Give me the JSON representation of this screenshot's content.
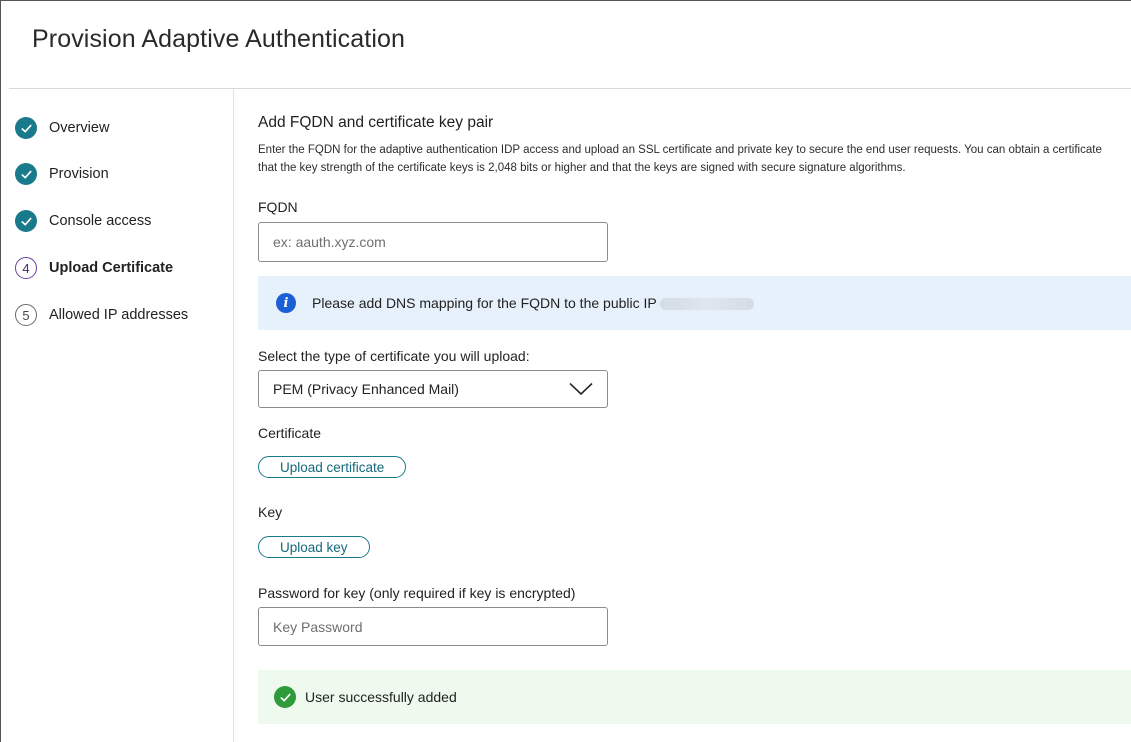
{
  "header": {
    "title": "Provision Adaptive Authentication"
  },
  "steps": [
    {
      "label": "Overview",
      "status": "done"
    },
    {
      "label": "Provision",
      "status": "done"
    },
    {
      "label": "Console access",
      "status": "done"
    },
    {
      "label": "Upload Certificate",
      "status": "current",
      "number": "4"
    },
    {
      "label": "Allowed IP addresses",
      "status": "pending",
      "number": "5"
    }
  ],
  "main": {
    "section_title": "Add FQDN and certificate key pair",
    "description_line1": "Enter the FQDN for the adaptive authentication IDP access and upload an SSL certificate and private key to secure the end user requests. You can obtain a certificate",
    "description_line2": "that the key strength of the certificate keys is 2,048 bits or higher and that the keys are signed with secure signature algorithms.",
    "fqdn": {
      "label": "FQDN",
      "placeholder": "ex: aauth.xyz.com",
      "value": ""
    },
    "info_banner": {
      "text": "Please add DNS mapping for the FQDN to the public IP"
    },
    "cert_type": {
      "label": "Select the type of certificate you will upload:",
      "selected": "PEM (Privacy Enhanced Mail)"
    },
    "certificate": {
      "label": "Certificate",
      "button": "Upload certificate"
    },
    "key": {
      "label": "Key",
      "button": "Upload key"
    },
    "password": {
      "label": "Password for key (only required if key is encrypted)",
      "placeholder": "Key Password",
      "value": ""
    },
    "success_banner": {
      "text": "User successfully added"
    }
  },
  "colors": {
    "accent": "#197a8c",
    "current_step": "#6b3fa0",
    "info_bg": "#e6f1fb",
    "info_icon": "#1a5fd6",
    "success_bg": "#eefaee",
    "success_icon": "#2e9a3a"
  },
  "icons": {
    "done_step": "check-circle-icon",
    "info": "info-icon",
    "dropdown": "chevron-down-icon",
    "success": "check-circle-icon"
  }
}
